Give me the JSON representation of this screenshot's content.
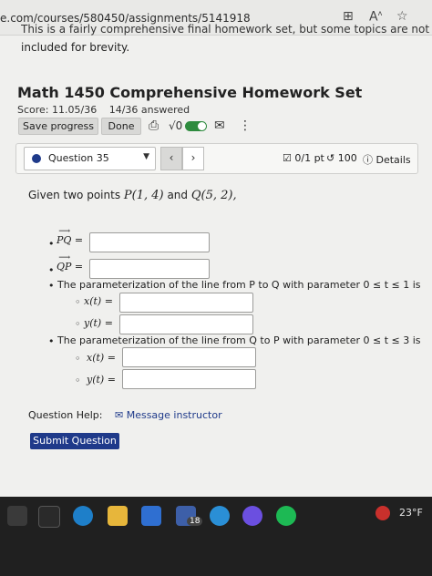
{
  "browser": {
    "url": "e.com/courses/580450/assignments/5141918",
    "icons": [
      "split-screen-icon",
      "read-aloud-icon",
      "favorite-star-icon"
    ]
  },
  "banner": {
    "cut_line": "This is a fairly comprehensive final homework set, but some topics are not",
    "rest_line": "included for brevity."
  },
  "assignment": {
    "title": "Math 1450 Comprehensive Homework Set",
    "score": "Score: 11.05/36",
    "answered": "14/36 answered",
    "save_label": "Save progress",
    "done_label": "Done"
  },
  "toolbar": {
    "sqrt_label": "√0"
  },
  "question": {
    "label": "Question 35",
    "points": "0/1 pt",
    "tries": "100",
    "details": "Details"
  },
  "problem": {
    "intro": "Given two points",
    "p_point": "P(1, 4)",
    "and": "and",
    "q_point": "Q(5, 2),",
    "pq_label": "PQ",
    "qp_label": "QP",
    "equals": "=",
    "param1_text": "The parameterization of the line from P to Q with parameter 0 ≤ t ≤ 1 is",
    "param2_text": "The parameterization of the line from Q to P with parameter 0 ≤ t ≤ 3 is",
    "x_label": "x(t) =",
    "y_label": "y(t) ="
  },
  "footer": {
    "help_label": "Question Help:",
    "message_label": "Message instructor",
    "submit_label": "Submit Question"
  },
  "taskbar": {
    "mail_badge": "18",
    "weather": "23°F"
  },
  "colors": {
    "accent": "#1f3a8a",
    "toggle_on": "#2e8b3e"
  }
}
